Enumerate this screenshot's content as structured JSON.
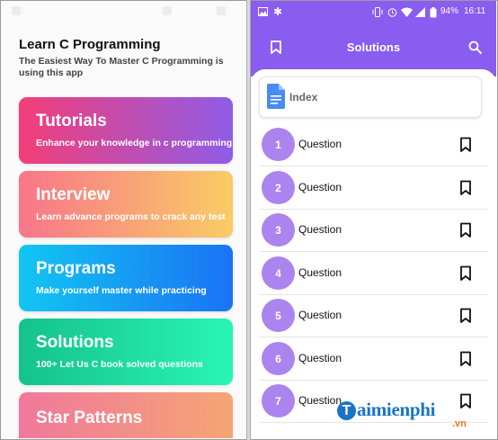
{
  "left_app": {
    "title": "Learn C Programming",
    "subtitle": "The Easiest Way To Master C Programming is using this app",
    "cards": [
      {
        "title": "Tutorials",
        "desc": "Enhance your knowledge in c programming",
        "gradient": [
          "#f33e78",
          "#8f5ce6"
        ]
      },
      {
        "title": "Interview",
        "desc": "Learn advance programs to crack any test",
        "gradient": [
          "#f8758a",
          "#f9cc65"
        ]
      },
      {
        "title": "Programs",
        "desc": "Make yourself master while practicing",
        "gradient": [
          "#12c6f2",
          "#1a73f5"
        ]
      },
      {
        "title": "Solutions",
        "desc": "100+ Let Us C book solved questions",
        "gradient": [
          "#14c28c",
          "#2af5b4"
        ]
      },
      {
        "title": "Star Patterns",
        "desc": "",
        "gradient": [
          "#f0789c",
          "#f5a574"
        ]
      }
    ]
  },
  "right_app": {
    "status": {
      "battery": "94%",
      "time": "16:11"
    },
    "header_title": "Solutions",
    "index_label": "Index",
    "questions": [
      {
        "num": "1",
        "label": "Question"
      },
      {
        "num": "2",
        "label": "Question"
      },
      {
        "num": "3",
        "label": "Question"
      },
      {
        "num": "4",
        "label": "Question"
      },
      {
        "num": "5",
        "label": "Question"
      },
      {
        "num": "6",
        "label": "Question"
      },
      {
        "num": "7",
        "label": "Question"
      }
    ],
    "accent": "#8a5cf0",
    "circle_color": "#ac84ef"
  },
  "watermark": {
    "brand": "aimienphi",
    "initial": "T",
    "suffix": ".vn"
  },
  "icons": [
    "bookmark-icon",
    "search-icon",
    "document-icon",
    "image-icon",
    "star-icon",
    "vibrate-icon",
    "wifi-icon",
    "signal-icon",
    "battery-icon"
  ]
}
